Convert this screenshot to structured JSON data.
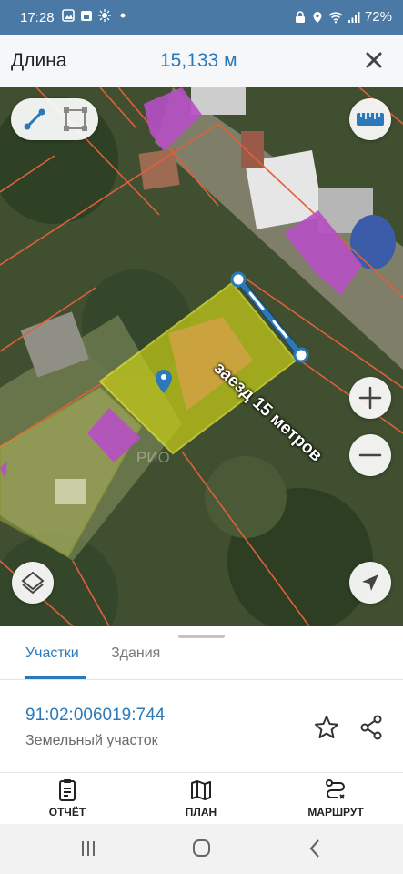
{
  "status_bar": {
    "time": "17:28",
    "battery": "72%",
    "left_icons": [
      "gallery-icon",
      "calendar-icon",
      "sun-icon",
      "dot-icon"
    ],
    "right_icons": [
      "lock-icon",
      "location-icon",
      "wifi-icon",
      "signal-icon"
    ]
  },
  "header": {
    "title": "Длина",
    "measurement": "15,133 м",
    "close_icon": "close-icon"
  },
  "map": {
    "annotation": "заезд 15 метров",
    "watermark": "РИО",
    "colors": {
      "parcel_fill": "#c9cf18",
      "building_fill": "#b64fc4",
      "boundary": "#e0603a",
      "measure_line": "#2b79b8",
      "pin": "#2b79b8"
    },
    "tools": [
      "line-measure-icon",
      "area-measure-icon"
    ],
    "controls": [
      "ruler-icon",
      "zoom-in-icon",
      "zoom-out-icon",
      "locate-icon",
      "layers-icon"
    ]
  },
  "tabs": [
    {
      "label": "Участки",
      "active": true
    },
    {
      "label": "Здания",
      "active": false
    }
  ],
  "parcel": {
    "number": "91:02:006019:744",
    "type": "Земельный участок"
  },
  "actions": [
    {
      "label": "ОТЧЁТ",
      "icon": "report-icon"
    },
    {
      "label": "ПЛАН",
      "icon": "map-plan-icon"
    },
    {
      "label": "МАРШРУТ",
      "icon": "route-icon"
    }
  ],
  "nav": [
    "recent-apps-icon",
    "home-icon",
    "back-icon"
  ]
}
